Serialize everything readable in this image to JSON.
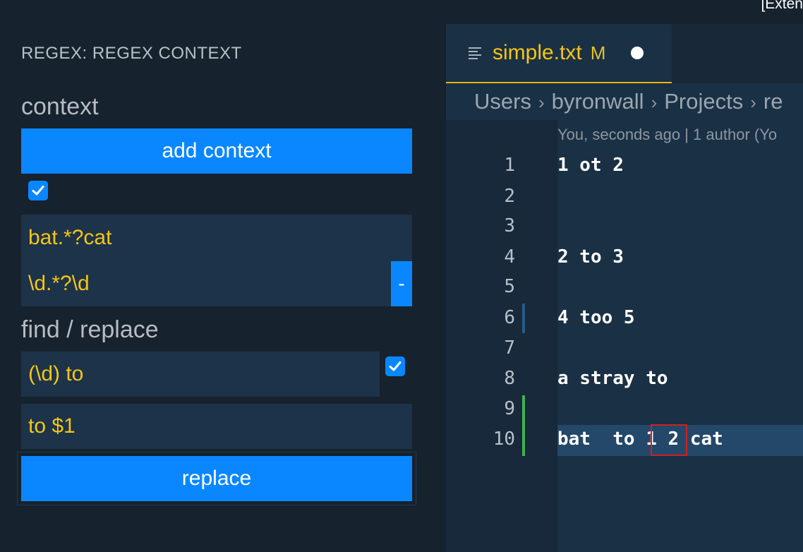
{
  "window": {
    "title_fragment": "[Exten"
  },
  "sidebar": {
    "panel_title": "REGEX: REGEX CONTEXT",
    "context": {
      "heading": "context",
      "add_button": "add context",
      "checked": true,
      "patterns": [
        "bat.*?cat",
        "\\d.*?\\d"
      ],
      "remove_button": "-"
    },
    "find_replace": {
      "heading": "find / replace",
      "find_value": "(\\d) to",
      "find_checked": true,
      "replace_value": "to $1",
      "replace_button": "replace"
    }
  },
  "editor": {
    "tab": {
      "filename": "simple.txt",
      "status": "M",
      "unsaved": true,
      "icon": "text-file-icon"
    },
    "breadcrumb": [
      "Users",
      "byronwall",
      "Projects",
      "re"
    ],
    "blame": "You, seconds ago | 1 author (Yo",
    "lines": [
      {
        "num": "1",
        "text": "1 ot 2"
      },
      {
        "num": "2",
        "text": ""
      },
      {
        "num": "3",
        "text": ""
      },
      {
        "num": "4",
        "text": "2 to 3"
      },
      {
        "num": "5",
        "text": ""
      },
      {
        "num": "6",
        "text": "4 too 5"
      },
      {
        "num": "7",
        "text": ""
      },
      {
        "num": "8",
        "text": "a stray to"
      },
      {
        "num": "9",
        "text": ""
      },
      {
        "num": "10",
        "text": "bat  to 1 2 cat"
      }
    ],
    "current_line": "10",
    "colors": {
      "accent": "#0a87ff",
      "highlight_text": "#f5c518",
      "added_diff": "#3fb24f",
      "modified_diff": "#2a5a85",
      "match_box": "#d21f1f"
    }
  }
}
